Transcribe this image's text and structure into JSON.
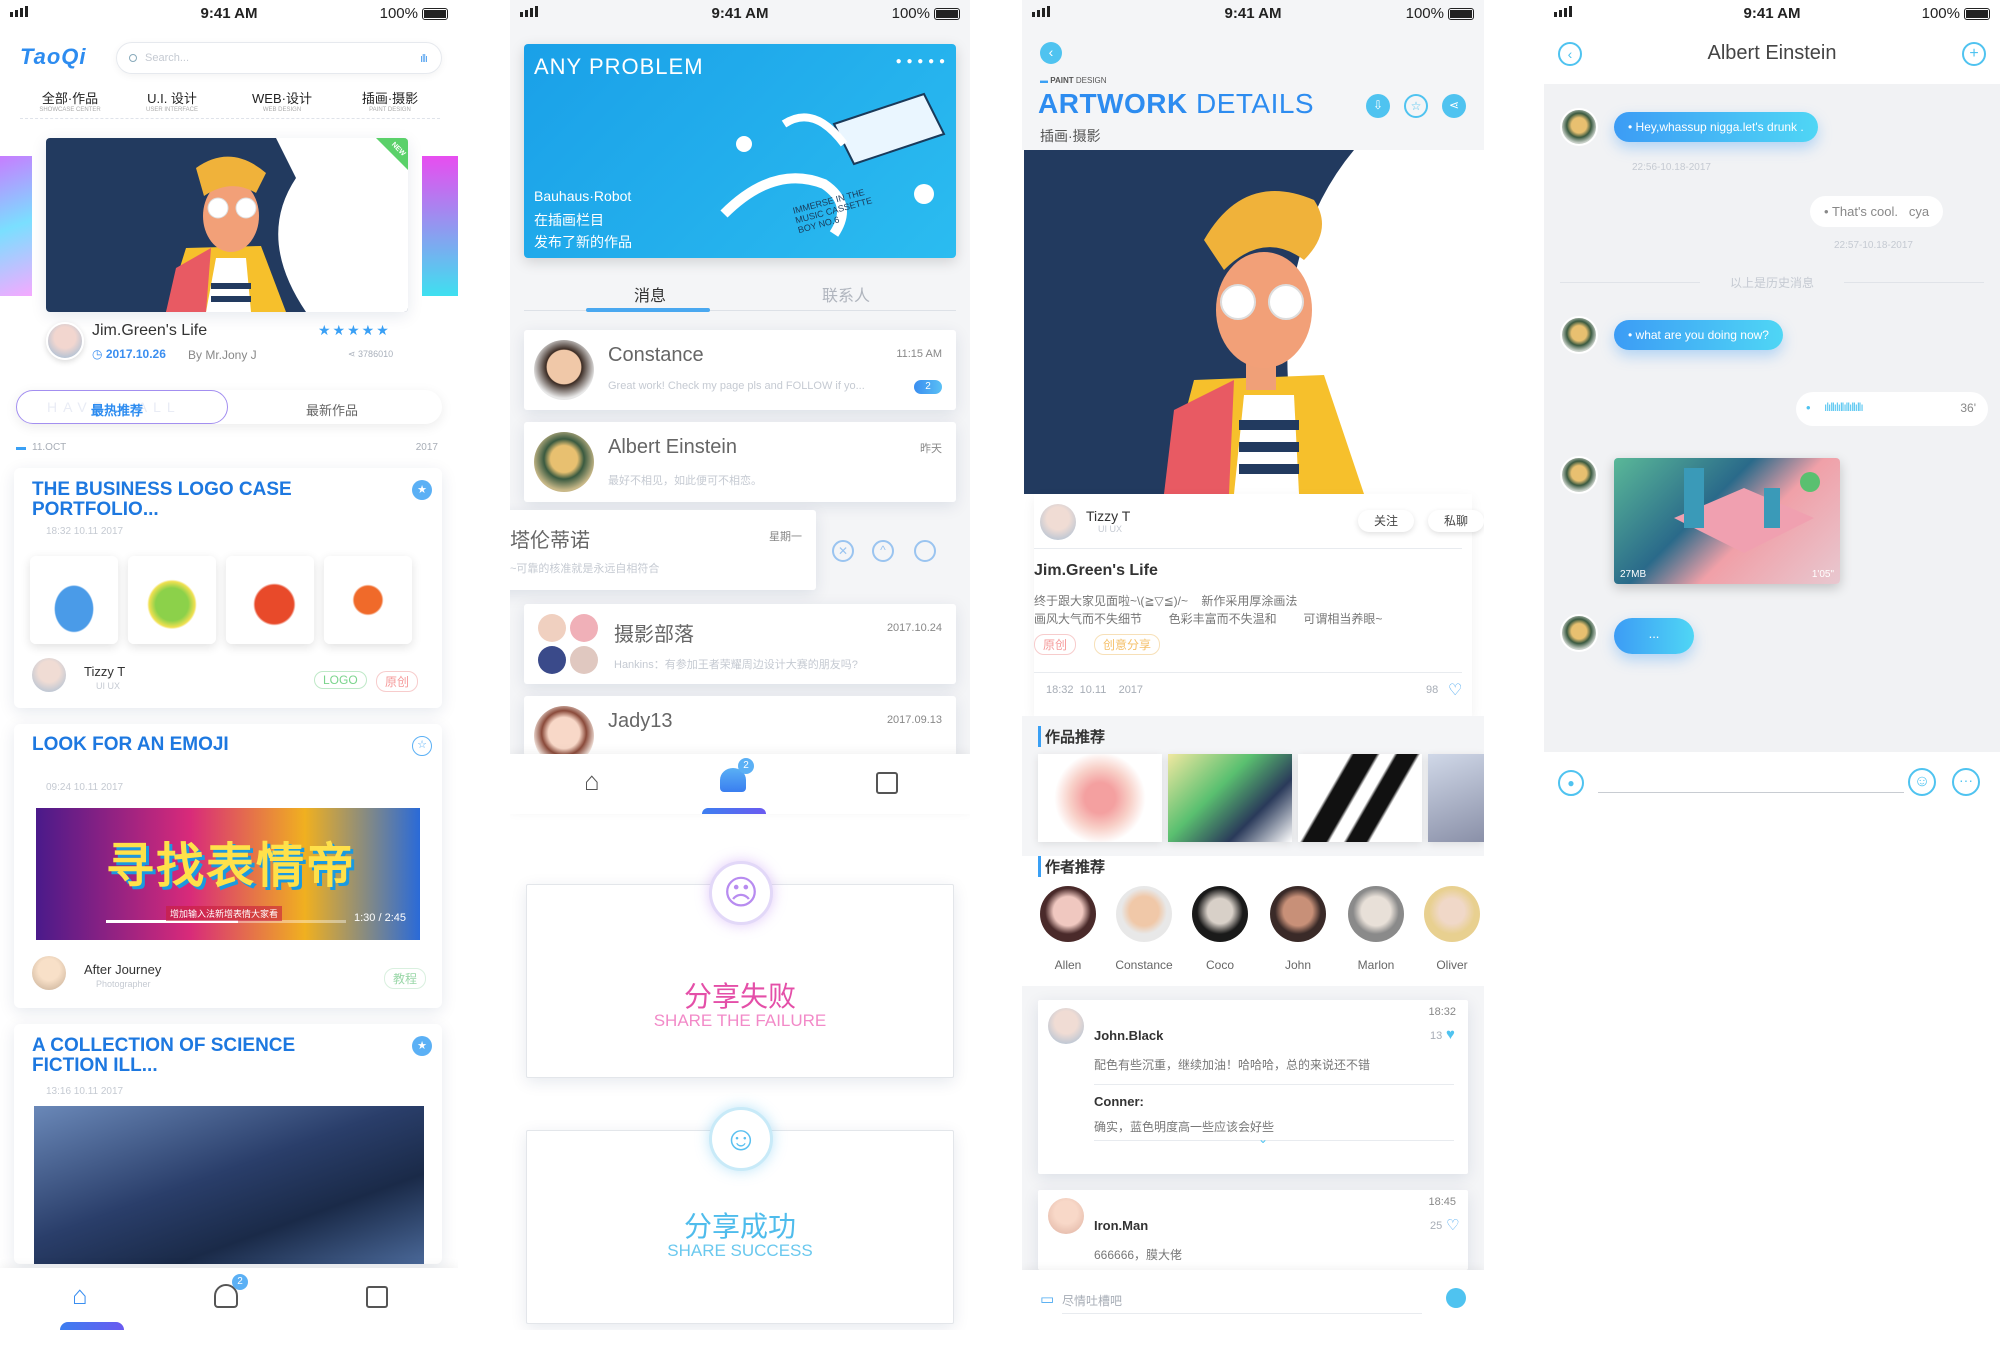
{
  "status": {
    "time": "9:41 AM",
    "battery": "100%"
  },
  "p1": {
    "logo": "TaoQi",
    "search_placeholder": "Search...",
    "categories": [
      {
        "cn": "全部·作品",
        "en": "SHOWCASE CENTER"
      },
      {
        "cn": "U.I. 设计",
        "en": "USER INTERFACE"
      },
      {
        "cn": "WEB·设计",
        "en": "WEB DESIGN"
      },
      {
        "cn": "插画·摄影",
        "en": "PAINT DESIGN"
      }
    ],
    "new_badge": "NEW",
    "feature_title": "Jim.Green's Life",
    "feature_date": "2017.10.26",
    "feature_by": "By Mr.Jony J",
    "feature_views": "3786010",
    "tab_hot": "最热推荐",
    "tab_hot_bg": "HAVE · ALL",
    "tab_new": "最新作品",
    "date_left": "11.OCT",
    "date_right": "2017",
    "posts": [
      {
        "title": "THE BUSINESS LOGO CASE PORTFOLIO...",
        "time": "18:32  10.11   2017",
        "author": "Tizzy T",
        "role": "UI UX",
        "tags": [
          "LOGO",
          "原创"
        ]
      },
      {
        "title": "LOOK FOR AN EMOJI",
        "time": "09:24  10.11   2017",
        "author": "After Journey",
        "role": "Photographer",
        "tags": [
          "教程"
        ],
        "video_caption": "增加输入法新增表情大家看",
        "video_time": "1:30  /  2:45",
        "art_text": "寻找表情帝"
      },
      {
        "title": "A COLLECTION OF SCIENCE FICTION ILL...",
        "time": "13:16  10.11   2017"
      }
    ],
    "nav_badge": "2"
  },
  "p2": {
    "banner_title": "ANY PROBLEM",
    "banner_lines": [
      "Bauhaus·Robot",
      "在插画栏目",
      "发布了新的作品"
    ],
    "banner_art_text": "IMMERSE IN THE MUSIC CASSETTE BOY NO.6",
    "tab_messages": "消息",
    "tab_contacts": "联系人",
    "messages": [
      {
        "name": "Constance",
        "time": "11:15 AM",
        "preview": "Great work! Check my page pls and FOLLOW if yo...",
        "badge": "2"
      },
      {
        "name": "Albert Einstein",
        "time": "昨天",
        "preview": "最好不相见，如此便可不相恋。"
      },
      {
        "name": "塔伦蒂诺",
        "time": "星期一",
        "preview": "~可靠的核准就是永远自相符合"
      },
      {
        "name": "摄影部落",
        "time": "2017.10.24",
        "preview": "Hankins：有参加王者荣耀周边设计大赛的朋友吗?"
      },
      {
        "name": "Jady13",
        "time": "2017.09.13",
        "preview": ""
      }
    ],
    "nav_badge": "2",
    "fail_cn": "分享失败",
    "fail_en": "SHARE THE FAILURE",
    "success_cn": "分享成功",
    "success_en": "SHARE SUCCESS"
  },
  "p3": {
    "kicker_strong": "PAINT",
    "kicker": "DESIGN",
    "title_strong": "ARTWORK",
    "title": "DETAILS",
    "category": "插画·摄影",
    "author": "Tizzy T",
    "role": "UI UX",
    "follow": "关注",
    "message": "私聊",
    "work_title": "Jim.Green's Life",
    "desc1": "终于跟大家见面啦~\\(≧▽≦)/~    新作采用厚涂画法",
    "desc2": "画风大气而不失细节        色彩丰富而不失温和        可谓相当养眼~",
    "tags": [
      "原创",
      "创意分享"
    ],
    "time": "18:32  10.11    2017",
    "likes": "98",
    "section_works": "作品推荐",
    "section_authors": "作者推荐",
    "authors": [
      "Allen",
      "Constance",
      "Coco",
      "John",
      "Marlon",
      "Oliver"
    ],
    "comments": [
      {
        "name": "John.Black",
        "time": "18:32",
        "likes": "13",
        "text": "配色有些沉重，继续加油！哈哈哈，总的来说还不错",
        "reply_name": "Conner:",
        "reply": "确实，蓝色明度高一些应该会好些"
      },
      {
        "name": "Iron.Man",
        "time": "18:45",
        "likes": "25",
        "text": "666666，膜大佬"
      }
    ],
    "input_placeholder": "尽情吐槽吧"
  },
  "p4": {
    "title": "Albert Einstein",
    "msgs": [
      {
        "text": "Hey,whassup nigga.let's drunk .",
        "time": "22:56-10.18-2017"
      },
      {
        "text": "That's cool.   cya",
        "time": "22:57-10.18-2017"
      },
      {
        "text": "what are you doing now?"
      },
      {
        "text": "36'"
      },
      {
        "text": "..."
      }
    ],
    "history": "以上是历史消息",
    "video_size": "27MB",
    "video_len": "1'05\""
  }
}
